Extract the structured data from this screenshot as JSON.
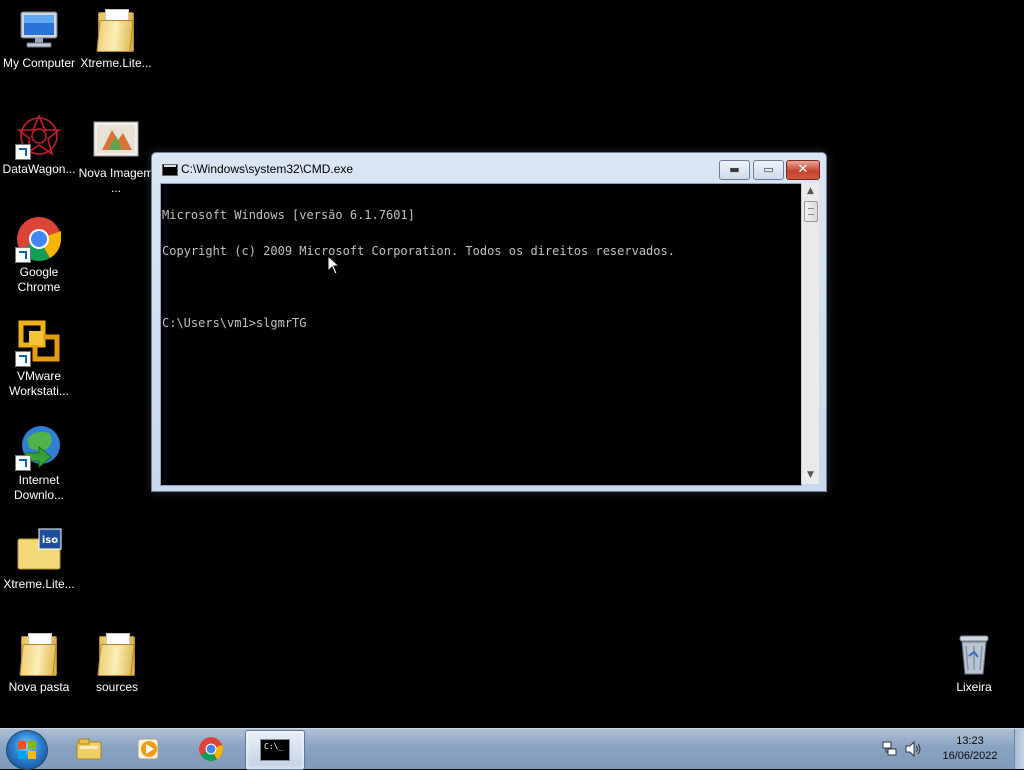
{
  "desktop": {
    "icons": [
      {
        "label": "My Computer",
        "icon": "computer-icon"
      },
      {
        "label": "Xtreme.Lite...",
        "icon": "folder-icon"
      },
      {
        "label": "DataWagon...",
        "icon": "datawagon-icon"
      },
      {
        "label": "Nova Imagem ...",
        "icon": "image-icon"
      },
      {
        "label": "Google Chrome",
        "icon": "chrome-icon"
      },
      {
        "label": "VMware Workstati...",
        "icon": "vmware-icon"
      },
      {
        "label": "Internet Downlo...",
        "icon": "idm-icon"
      },
      {
        "label": "Xtreme.Lite...",
        "icon": "iso-icon"
      },
      {
        "label": "Nova pasta",
        "icon": "folder-icon"
      },
      {
        "label": "sources",
        "icon": "folder-icon"
      },
      {
        "label": "Lixeira",
        "icon": "recycle-bin-icon"
      }
    ]
  },
  "window": {
    "title": "C:\\Windows\\system32\\CMD.exe",
    "controls": {
      "minimize": "▬",
      "maximize": "▭",
      "close": "✕"
    },
    "console": {
      "line1": "Microsoft Windows [versão 6.1.7601]",
      "line2": "Copyright (c) 2009 Microsoft Corporation. Todos os direitos reservados.",
      "line3": "C:\\Users\\vm1>slgmrTG"
    }
  },
  "taskbar": {
    "start": "start-orb-icon",
    "pinned": [
      {
        "name": "explorer",
        "icon": "explorer-folder-icon"
      },
      {
        "name": "media-player",
        "icon": "media-player-icon"
      },
      {
        "name": "chrome",
        "icon": "chrome-icon"
      },
      {
        "name": "cmd",
        "icon": "cmd-icon",
        "active": true,
        "glyph": "C:\\_"
      }
    ],
    "clock": {
      "time": "13:23",
      "date": "16/06/2022"
    }
  },
  "colors": {
    "desktop": "#000000",
    "console_text": "#c0c0c0",
    "titlebar": "#c9d8ec",
    "taskbar": "#8aa3c2",
    "close_button": "#c4432d"
  }
}
